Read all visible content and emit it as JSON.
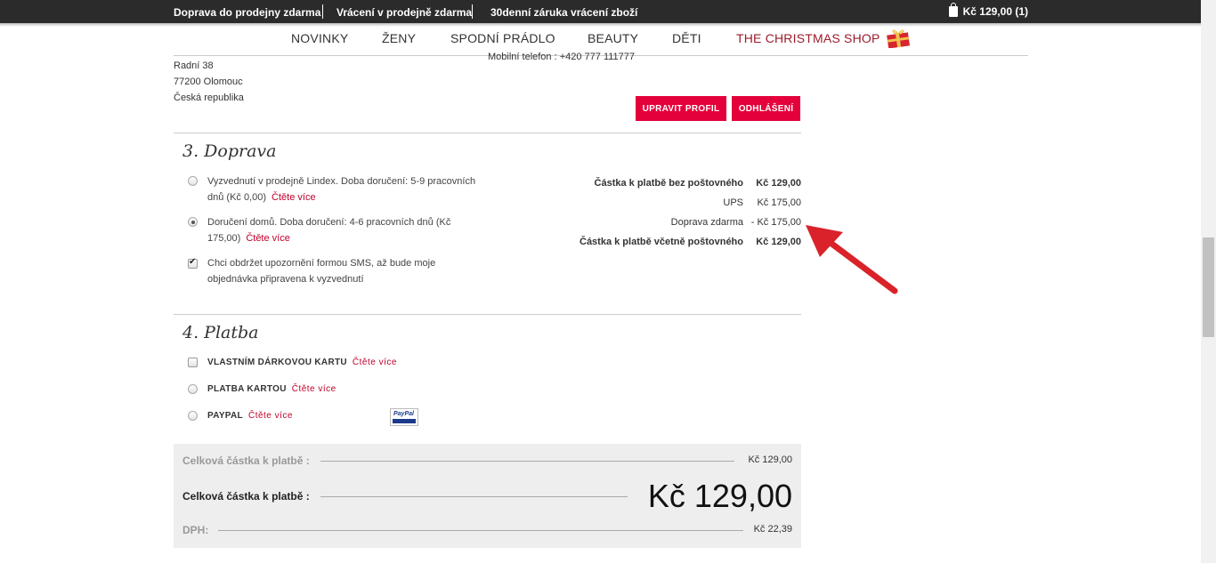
{
  "topbar": {
    "promo1": "Doprava do prodejny zdarma",
    "promo2": "Vrácení v prodejně zdarma",
    "promo3": "30denní záruka vrácení zboží",
    "cart": "Kč 129,00 (1)"
  },
  "nav": {
    "items": [
      "NOVINKY",
      "ŽENY",
      "SPODNÍ PRÁDLO",
      "BEAUTY",
      "DĚTI",
      "THE CHRISTMAS SHOP"
    ]
  },
  "address": {
    "street": "Radní 38",
    "city": "77200 Olomouc",
    "country": "Česká republika",
    "mobile": "Mobilní telefon : +420 777 111777"
  },
  "buttons": {
    "edit_profile": "UPRAVIT PROFIL",
    "logout": "ODHLÁŠENÍ"
  },
  "shipping": {
    "title": "3. Doprava",
    "option1_line1": "Vyzvednutí v prodejně Lindex. Doba doručení: 5-9 pracovních",
    "option1_line2": "dnů (Kč 0,00)",
    "option2_line1": "Doručení domů. Doba doručení: 4-6 pracovních dnů (Kč",
    "option2_line2": "175,00)",
    "sms_line1": "Chci obdržet upozornění formou SMS, až bude moje",
    "sms_line2": "objednávka připravena k vyzvednutí",
    "read_more": "Čtěte více",
    "summary": {
      "row1_label": "Částka k platbě bez poštovného",
      "row1_value": "Kč 129,00",
      "row2_label": "UPS",
      "row2_value": "Kč 175,00",
      "row3_label": "Doprava zdarma",
      "row3_value": "- Kč 175,00",
      "row4_label": "Částka k platbě včetně poštovného",
      "row4_value": "Kč 129,00"
    }
  },
  "payment": {
    "title": "4. Platba",
    "opt1": "VLASTNÍM DÁRKOVOU KARTU",
    "opt2": "PLATBA KARTOU",
    "opt3": "PAYPAL",
    "read_more": "Čtěte více",
    "paypal_logo": "PayPal"
  },
  "totals": {
    "subtotal_label": "Celková částka k platbě :",
    "subtotal_value": "Kč 129,00",
    "total_label": "Celková částka k platbě :",
    "total_value": "Kč 129,00",
    "vat_label": "DPH:",
    "vat_value": "Kč 22,39"
  },
  "colors": {
    "accent": "#e4003a",
    "link": "#c0002a",
    "arrow": "#d9222a",
    "topbar": "#2b2b2b"
  }
}
